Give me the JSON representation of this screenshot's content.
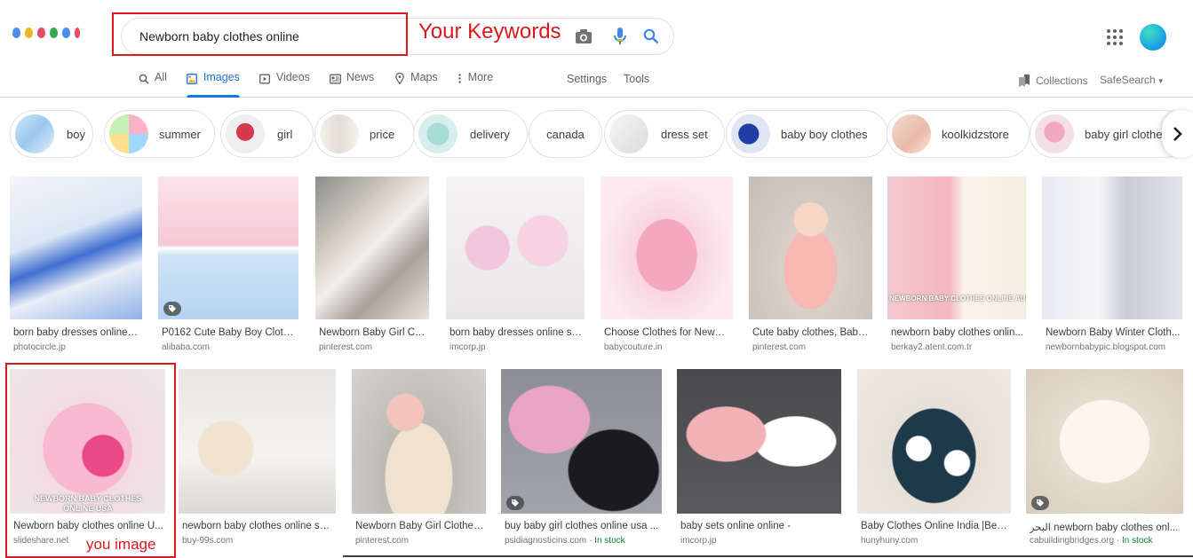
{
  "header": {
    "search_value": "Newborn baby clothes online",
    "keywords_annotation": "Your Keywords"
  },
  "tabs": [
    {
      "label": "All",
      "icon": "search-icon",
      "active": false
    },
    {
      "label": "Images",
      "icon": "image-icon",
      "active": true
    },
    {
      "label": "Videos",
      "icon": "video-icon",
      "active": false
    },
    {
      "label": "News",
      "icon": "news-icon",
      "active": false
    },
    {
      "label": "Maps",
      "icon": "map-pin-icon",
      "active": false
    },
    {
      "label": "More",
      "icon": "more-vert-icon",
      "active": false
    }
  ],
  "tools": {
    "settings": "Settings",
    "tools": "Tools",
    "collections": "Collections",
    "safesearch": "SafeSearch"
  },
  "chips": [
    {
      "label": "boy"
    },
    {
      "label": "summer"
    },
    {
      "label": "girl"
    },
    {
      "label": "price"
    },
    {
      "label": "delivery"
    },
    {
      "label": "canada"
    },
    {
      "label": "dress set"
    },
    {
      "label": "baby boy clothes"
    },
    {
      "label": "koolkidzstore"
    },
    {
      "label": "baby girl clothes"
    }
  ],
  "results_row1": [
    {
      "title": "born baby dresses online s...",
      "site": "photocircle.jp"
    },
    {
      "title": "P0162 Cute Baby Boy Clothe...",
      "site": "alibaba.com"
    },
    {
      "title": "Newborn Baby Girl Coa...",
      "site": "pinterest.com"
    },
    {
      "title": "born baby dresses online sh...",
      "site": "imcorp.jp"
    },
    {
      "title": "Choose Clothes for Newbo...",
      "site": "babycouture.in"
    },
    {
      "title": "Cute baby clothes, Baby ...",
      "site": "pinterest.com"
    },
    {
      "title": "newborn baby clothes onlin...",
      "site": "berkay2.atent.com.tr"
    },
    {
      "title": "Newborn Baby Winter Cloth...",
      "site": "newbornbabypic.blogspot.com"
    }
  ],
  "results_row2": [
    {
      "title": "Newborn baby clothes online U...",
      "site": "slideshare.net",
      "stock": ""
    },
    {
      "title": "newborn baby clothes online sal...",
      "site": "buy-99s.com",
      "stock": ""
    },
    {
      "title": "Newborn Baby Girl Clothes...",
      "site": "pinterest.com",
      "stock": ""
    },
    {
      "title": "buy baby girl clothes online usa ...",
      "site": "psidiagnosticins.com",
      "stock": "In stock"
    },
    {
      "title": "baby sets online online -",
      "site": "imcorp.jp",
      "stock": ""
    },
    {
      "title": "Baby Clothes Online India |Best ...",
      "site": "hunyhuny.com",
      "stock": ""
    },
    {
      "title": "البحر newborn baby clothes onl...",
      "site": "cabuildingbridges.org",
      "stock": "In stock"
    }
  ],
  "image_text": {
    "r1_7": "NEWBORN BABY CLOTHES ONLINE AUSTRALIA",
    "r2_1_line1": "NEWBORN BABY CLOTHES",
    "r2_1_line2": "ONLINE USA"
  },
  "separator": "·",
  "you_annotation": "you image",
  "colors": {
    "accent": "#1a73e8",
    "annotation_red": "#d9191e",
    "instock_green": "#188038"
  }
}
